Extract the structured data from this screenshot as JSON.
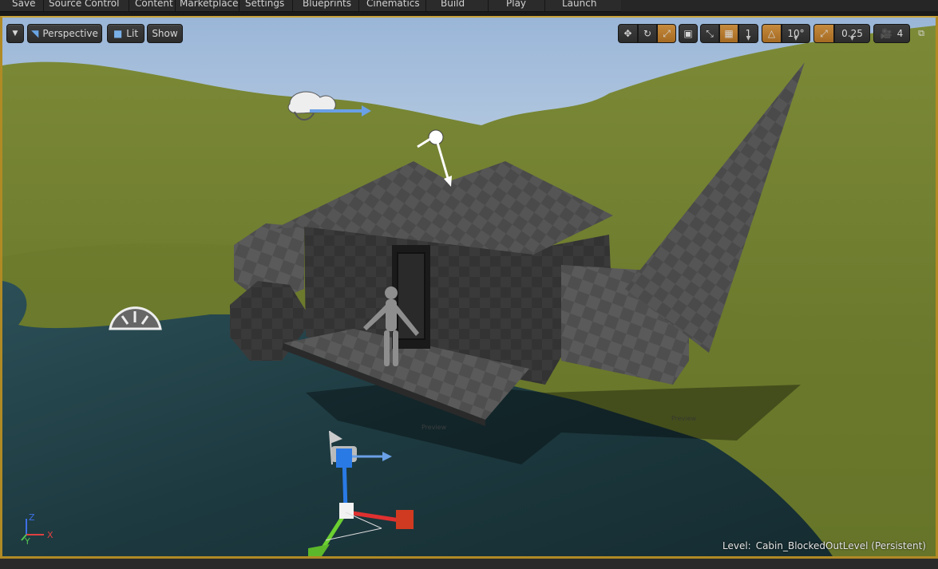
{
  "toolbar": {
    "items": [
      "Save",
      "Source Control",
      "Content",
      "Marketplace",
      "Settings",
      "Blueprints",
      "Cinematics",
      "Build",
      "Play",
      "Launch"
    ]
  },
  "viewport": {
    "view_mode_label": "Perspective",
    "lighting_label": "Lit",
    "show_label": "Show",
    "grid_snap_value": "1",
    "rotation_snap_value": "10°",
    "scale_snap_value": "0.25",
    "camera_speed_value": "4",
    "level_prefix": "Level:",
    "level_name": "Cabin_BlockedOutLevel (Persistent)",
    "axis_labels": {
      "z": "Z",
      "x": "X",
      "y": "Y"
    },
    "preview_text": "Preview"
  },
  "colors": {
    "accent": "#c8a23a",
    "active_button": "#b8782e",
    "sky": "#a9c3df",
    "grass": "#6b7a2c",
    "water": "#1f3a40"
  },
  "icons": [
    "menu-chevron-icon",
    "perspective-camera-icon",
    "lit-cube-icon",
    "translate-icon",
    "rotate-icon",
    "scale-icon",
    "surface-snap-icon",
    "world-local-icon",
    "grid-snap-icon",
    "rotation-snap-icon",
    "scale-snap-icon",
    "camera-speed-icon",
    "maximize-icon"
  ]
}
